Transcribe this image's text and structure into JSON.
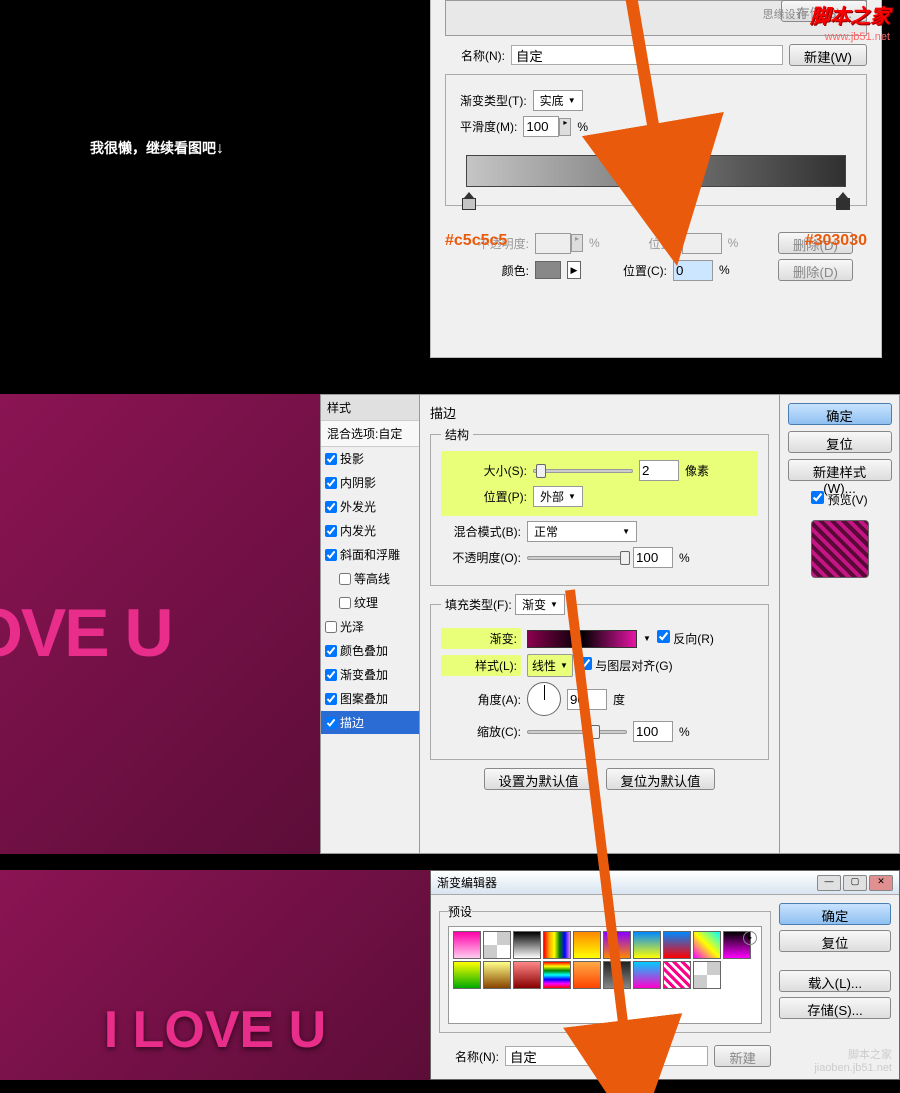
{
  "watermark": {
    "gray": "思缘设计",
    "red": "脚本之家",
    "url": "www.jb51.net",
    "bottom": "脚本之家",
    "bottom_url": "jiaoben.jb51.net"
  },
  "caption": "我很懒，继续看图吧",
  "panel1": {
    "save_btn": "存储(S)...",
    "name_label": "名称(N):",
    "name_value": "自定",
    "new_btn": "新建(W)",
    "type_label": "渐变类型(T):",
    "type_value": "实底",
    "smooth_label": "平滑度(M):",
    "smooth_value": "100",
    "percent": "%",
    "hex_left": "#c5c5c5",
    "hex_right": "#303030",
    "opacity_label": "不透明度:",
    "pos_label": "位置:",
    "del_btn": "删除(D)",
    "color_label": "颜色:",
    "pos2_label": "位置(C):",
    "pos2_value": "0"
  },
  "panel2": {
    "preview_text": "OVE U",
    "styles_header": "样式",
    "styles_sub": "混合选项:自定",
    "styles": [
      {
        "label": "投影",
        "checked": true
      },
      {
        "label": "内阴影",
        "checked": true
      },
      {
        "label": "外发光",
        "checked": true
      },
      {
        "label": "内发光",
        "checked": true
      },
      {
        "label": "斜面和浮雕",
        "checked": true
      },
      {
        "label": "等高线",
        "checked": false,
        "indent": true
      },
      {
        "label": "纹理",
        "checked": false,
        "indent": true
      },
      {
        "label": "光泽",
        "checked": false
      },
      {
        "label": "颜色叠加",
        "checked": true
      },
      {
        "label": "渐变叠加",
        "checked": true
      },
      {
        "label": "图案叠加",
        "checked": true
      },
      {
        "label": "描边",
        "checked": true,
        "selected": true
      }
    ],
    "section_title": "描边",
    "structure": "结构",
    "size_label": "大小(S):",
    "size_value": "2",
    "size_unit": "像素",
    "pos_label": "位置(P):",
    "pos_value": "外部",
    "blend_label": "混合模式(B):",
    "blend_value": "正常",
    "opacity_label": "不透明度(O):",
    "opacity_value": "100",
    "fill_label": "填充类型(F):",
    "fill_value": "渐变",
    "grad_label": "渐变:",
    "reverse_label": "反向(R)",
    "style_label": "样式(L):",
    "style_value": "线性",
    "align_label": "与图层对齐(G)",
    "angle_label": "角度(A):",
    "angle_value": "90",
    "angle_unit": "度",
    "scale_label": "缩放(C):",
    "scale_value": "100",
    "default_btn": "设置为默认值",
    "reset_btn": "复位为默认值",
    "ok_btn": "确定",
    "cancel_btn": "复位",
    "newstyle_btn": "新建样式(W)...",
    "preview_chk": "预览(V)"
  },
  "panel3": {
    "preview_text": "I LOVE U",
    "title": "渐变编辑器",
    "presets_label": "预设",
    "ok_btn": "确定",
    "cancel_btn": "复位",
    "load_btn": "载入(L)...",
    "save_btn": "存储(S)...",
    "name_label": "名称(N):",
    "name_value": "自定",
    "new_btn": "新建"
  },
  "gradient_swatches": [
    "linear-gradient(#f0a,#fce)",
    "repeating-conic-gradient(#ccc 0 25%,#fff 0 50%)",
    "linear-gradient(#000,#fff)",
    "linear-gradient(90deg,red,orange,yellow,green,blue,violet)",
    "linear-gradient(#f80,#ff0)",
    "linear-gradient(#80f,#f80)",
    "linear-gradient(#08f,#ff0)",
    "linear-gradient(#08f,#f00)",
    "linear-gradient(45deg,#f0f,#ff0,#0ff)",
    "linear-gradient(#000,#f0f)",
    "linear-gradient(#ff0,#0a0)",
    "linear-gradient(#ff8,#840)",
    "linear-gradient(#f88,#800)",
    "linear-gradient(red,yellow,green,cyan,blue,magenta,red)",
    "linear-gradient(#fa4,#f40)",
    "linear-gradient(#222,#888)",
    "linear-gradient(#0cf,#f0c)",
    "repeating-linear-gradient(45deg,#f08,#f08 3px,#fff 3px,#fff 6px)",
    "repeating-conic-gradient(#ccc 0 25%,#fff 0 50%)"
  ]
}
